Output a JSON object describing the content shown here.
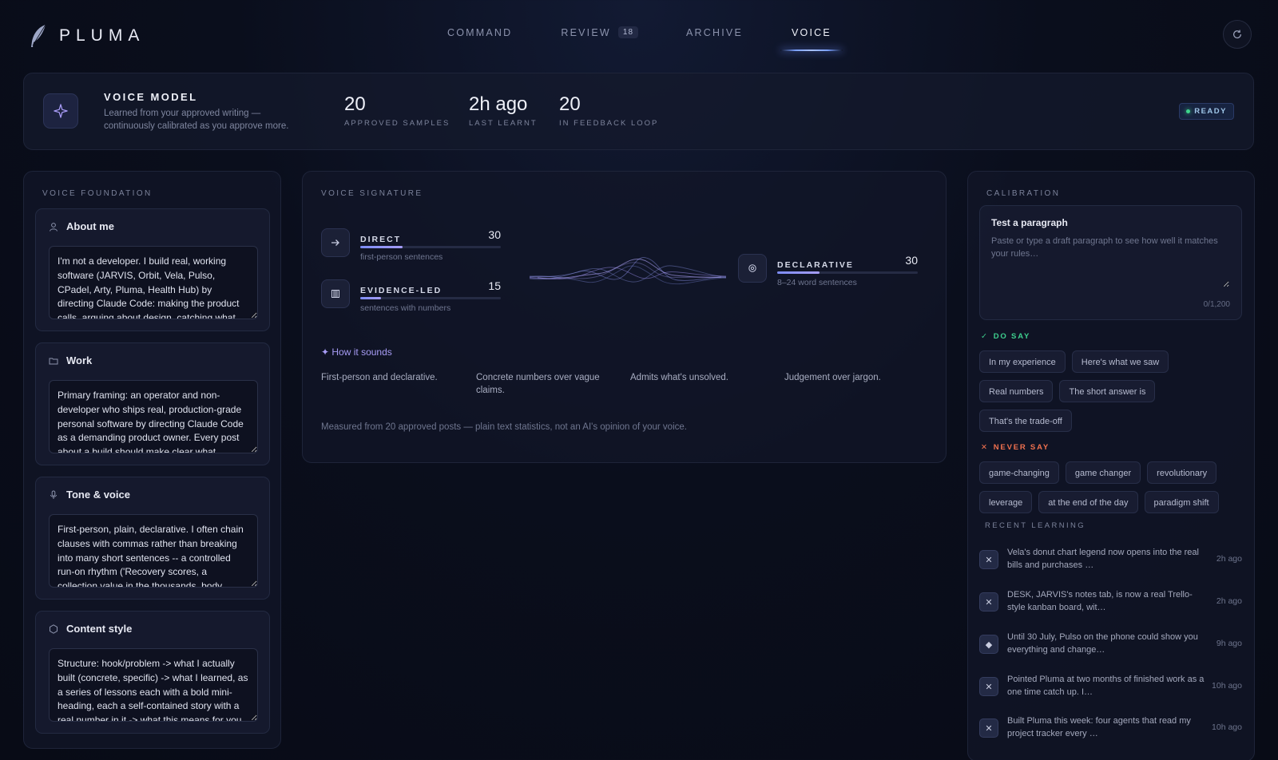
{
  "app": {
    "name": "PLUMA"
  },
  "nav": {
    "items": [
      {
        "label": "COMMAND"
      },
      {
        "label": "REVIEW",
        "badge": "18"
      },
      {
        "label": "ARCHIVE"
      },
      {
        "label": "VOICE",
        "active": true
      }
    ]
  },
  "voice_model": {
    "title": "VOICE MODEL",
    "subtitle": "Learned from your approved writing — continuously calibrated as you approve more.",
    "stats": [
      {
        "value": "20",
        "label": "APPROVED SAMPLES"
      },
      {
        "value": "2h ago",
        "label": "LAST LEARNT"
      },
      {
        "value": "20",
        "label": "IN FEEDBACK LOOP"
      }
    ],
    "status": "READY"
  },
  "foundation": {
    "title": "VOICE FOUNDATION",
    "cards": [
      {
        "icon": "user-icon",
        "title": "About me",
        "value": "I'm not a developer. I build real, working software (JARVIS, Orbit, Vela, Pulso, CPadel, Arty, Pluma, Health Hub) by directing Claude Code: making the product calls, arguing about design, catching what looks wrong"
      },
      {
        "icon": "folder-icon",
        "title": "Work",
        "value": "Primary framing: an operator and non-developer who ships real, production-grade personal software by directing Claude Code as a demanding product owner. Every post about a build should make clear what"
      },
      {
        "icon": "microphone-icon",
        "title": "Tone & voice",
        "value": "First-person, plain, declarative. I often chain clauses with commas rather than breaking into many short sentences -- a controlled run-on rhythm ('Recovery scores, a collection value in the thousands, body"
      },
      {
        "icon": "hexagon-icon",
        "title": "Content style",
        "value": "Structure: hook/problem -> what I actually built (concrete, specific) -> what I learned, as a series of lessons each with a bold mini-heading, each a self-contained story with a real number in it -> what this means for you"
      }
    ]
  },
  "signature": {
    "title": "VOICE SIGNATURE",
    "metrics": [
      {
        "icon": "arrow-right-icon",
        "label": "DIRECT",
        "value": 30,
        "sub": "first-person sentences"
      },
      {
        "icon": "bars-icon",
        "label": "EVIDENCE-LED",
        "value": 15,
        "sub": "sentences with numbers"
      },
      {
        "icon": "target-icon",
        "label": "DECLARATIVE",
        "value": 30,
        "sub": "8–24 word sentences"
      }
    ],
    "how_label": "✦ How it sounds",
    "sounds": [
      "First-person and declarative.",
      "Concrete numbers over vague claims.",
      "Admits what's unsolved.",
      "Judgement over jargon."
    ],
    "footnote": "Measured from 20 approved posts — plain text statistics, not an AI's opinion of your voice."
  },
  "calibration": {
    "title": "CALIBRATION",
    "test_title": "Test a paragraph",
    "placeholder": "Paste or type a draft paragraph to see how well it matches your rules…",
    "count": "0/1,200",
    "do_say_label": "DO SAY",
    "do_say": [
      "In my experience",
      "Here's what we saw",
      "Real numbers",
      "The short answer is",
      "That's the trade-off"
    ],
    "never_say_label": "NEVER SAY",
    "never_say": [
      "game-changing",
      "game changer",
      "revolutionary",
      "leverage",
      "at the end of the day",
      "paradigm shift"
    ],
    "colors": {
      "do": "#3ecf8e",
      "never": "#f0714f"
    }
  },
  "learning": {
    "title": "RECENT LEARNING",
    "items": [
      {
        "icon": "x-icon",
        "text": "Vela's donut chart legend now opens into the real bills and purchases …",
        "time": "2h ago"
      },
      {
        "icon": "x-icon",
        "text": "DESK, JARVIS's notes tab, is now a real Trello-style kanban board, wit…",
        "time": "2h ago"
      },
      {
        "icon": "diamond-icon",
        "text": "Until 30 July, Pulso on the phone could show you everything and change…",
        "time": "9h ago"
      },
      {
        "icon": "x-icon",
        "text": "Pointed Pluma at two months of finished work as a one time catch up. I…",
        "time": "10h ago"
      },
      {
        "icon": "x-icon",
        "text": "Built Pluma this week: four agents that read my project tracker every …",
        "time": "10h ago"
      }
    ]
  }
}
